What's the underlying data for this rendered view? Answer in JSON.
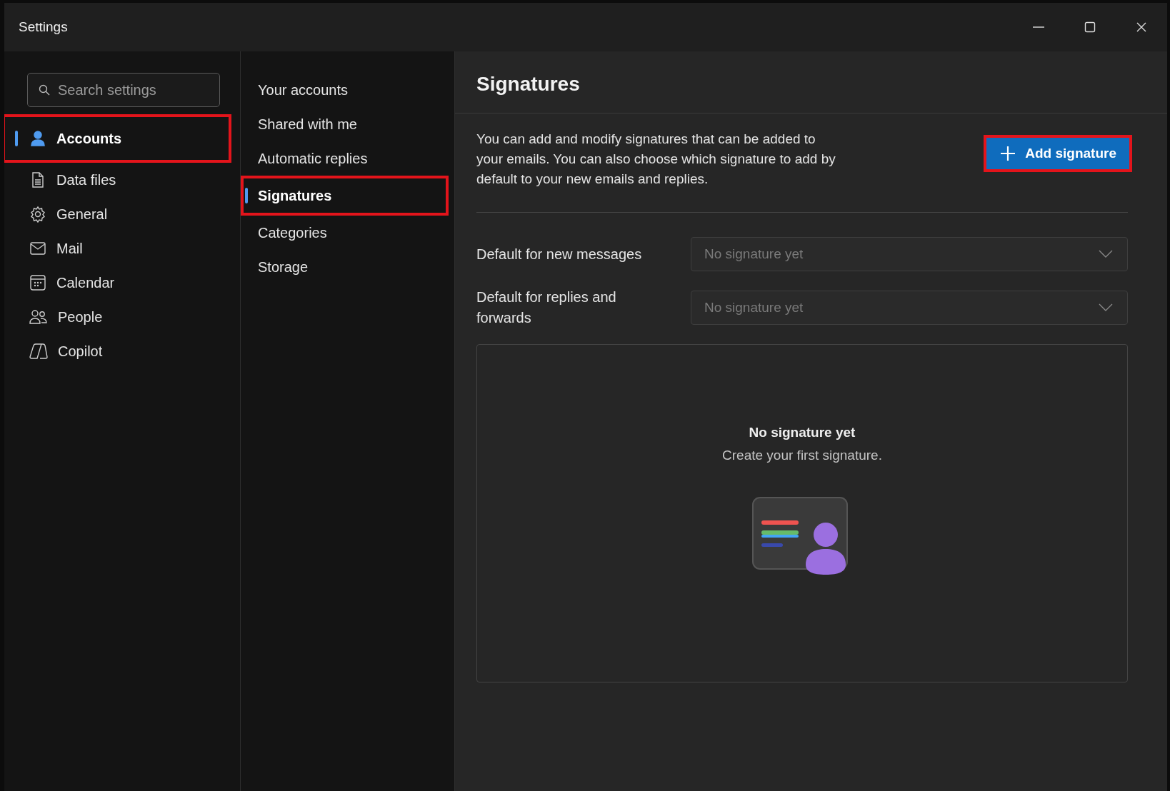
{
  "window": {
    "title": "Settings"
  },
  "search": {
    "placeholder": "Search settings"
  },
  "sidebar": {
    "items": [
      {
        "label": "Accounts",
        "selected": true,
        "annotated": true
      },
      {
        "label": "Data files",
        "selected": false,
        "annotated": false
      },
      {
        "label": "General",
        "selected": false,
        "annotated": false
      },
      {
        "label": "Mail",
        "selected": false,
        "annotated": false
      },
      {
        "label": "Calendar",
        "selected": false,
        "annotated": false
      },
      {
        "label": "People",
        "selected": false,
        "annotated": false
      },
      {
        "label": "Copilot",
        "selected": false,
        "annotated": false
      }
    ]
  },
  "subnav": {
    "items": [
      {
        "label": "Your accounts",
        "selected": false,
        "annotated": false
      },
      {
        "label": "Shared with me",
        "selected": false,
        "annotated": false
      },
      {
        "label": "Automatic replies",
        "selected": false,
        "annotated": false
      },
      {
        "label": "Signatures",
        "selected": true,
        "annotated": true
      },
      {
        "label": "Categories",
        "selected": false,
        "annotated": false
      },
      {
        "label": "Storage",
        "selected": false,
        "annotated": false
      }
    ]
  },
  "content": {
    "title": "Signatures",
    "description": "You can add and modify signatures that can be added to your emails. You can also choose which signature to add by default to your new emails and replies.",
    "add_button": {
      "label": "Add signature",
      "annotated": true
    },
    "defaults": [
      {
        "label": "Default for new messages",
        "placeholder": "No signature yet"
      },
      {
        "label": "Default for replies and forwards",
        "placeholder": "No signature yet"
      }
    ],
    "empty_state": {
      "title": "No signature yet",
      "subtitle": "Create your first signature."
    }
  }
}
